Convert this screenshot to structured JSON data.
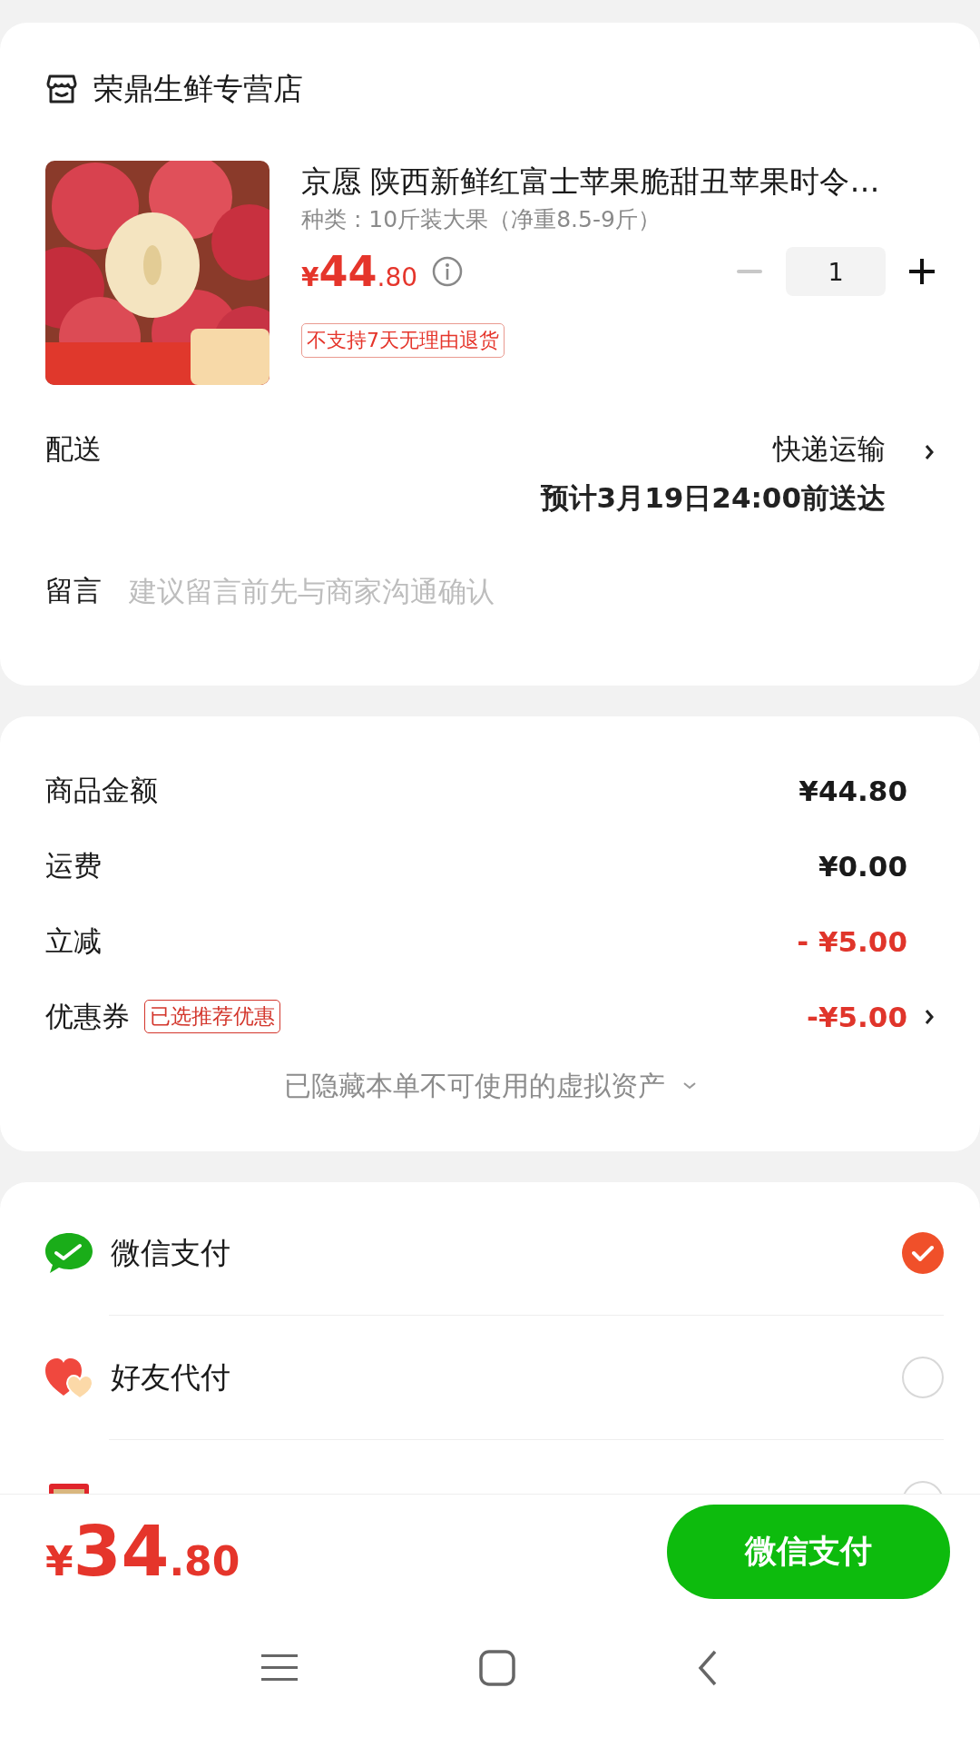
{
  "shop": {
    "name": "荣鼎生鲜专营店"
  },
  "product": {
    "title": "京愿 陕西新鲜红富士苹果脆甜丑苹果时令…",
    "spec": "种类 : 10斤装大果（净重8.5-9斤）",
    "price": {
      "currency": "¥",
      "integer": "44",
      "decimal": ".80"
    },
    "quantity": "1",
    "tag": "不支持7天无理由退货"
  },
  "delivery": {
    "label": "配送",
    "method": "快递运输",
    "eta": "预计3月19日24:00前送达"
  },
  "message": {
    "label": "留言",
    "placeholder": "建议留言前先与商家沟通确认"
  },
  "summary": {
    "rows": [
      {
        "kind": "plain",
        "label": "商品金额",
        "value": "¥44.80"
      },
      {
        "kind": "plain",
        "label": "运费",
        "value": "¥0.00"
      },
      {
        "kind": "discount",
        "label": "立减",
        "value": "- ¥5.00"
      },
      {
        "kind": "coupon",
        "label": "优惠券",
        "badge": "已选推荐优惠",
        "value": "-¥5.00"
      }
    ],
    "hidden_note": "已隐藏本单不可使用的虚拟资产"
  },
  "payment_methods": [
    {
      "kind": "wechat",
      "label": "微信支付",
      "selected": true
    },
    {
      "kind": "friend",
      "label": "好友代付",
      "selected": false
    },
    {
      "kind": "card",
      "selected": false
    }
  ],
  "footer": {
    "total": {
      "currency": "¥",
      "integer": "34",
      "decimal": ".80"
    },
    "pay_button": "微信支付"
  }
}
